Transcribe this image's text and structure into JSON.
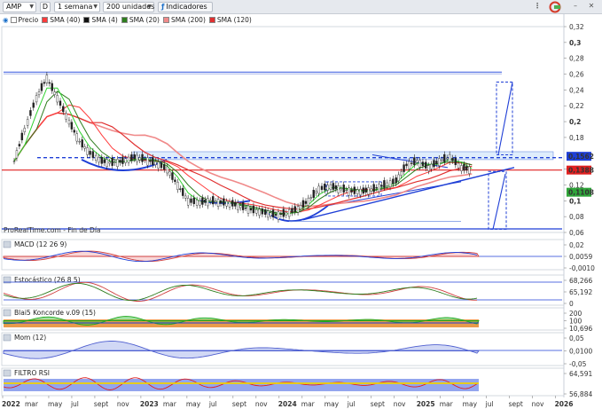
{
  "toolbar": {
    "ticker": "AMP",
    "d_label": "D",
    "period": "1 semana",
    "units": "200 unidades",
    "indicators": "Indicadores"
  },
  "legend": [
    {
      "label": "Precio",
      "color": "#ffffff"
    },
    {
      "label": "SMA (40)",
      "color": "#ff3b3b"
    },
    {
      "label": "SMA (4)",
      "color": "#111111"
    },
    {
      "label": "SMA (20)",
      "color": "#2e7d1e"
    },
    {
      "label": "SMA (200)",
      "color": "#f08a8a"
    },
    {
      "label": "SMA (120)",
      "color": "#e03030"
    }
  ],
  "watermark": "ProRealTime.com - Fin de Día",
  "price_axis": {
    "ticks": [
      "0,32",
      "0,3",
      "0,28",
      "0,26",
      "0,24",
      "0,22",
      "0,2",
      "0,18",
      "0,14",
      "0,12",
      "0,1",
      "0,08",
      "0,06"
    ],
    "bold_ticks": [
      "0,3",
      "0,2",
      "0,1"
    ],
    "badges": [
      {
        "text": "0,1562",
        "bg": "#1f3fd6"
      },
      {
        "text": "0,1388",
        "bg": "#e02020"
      },
      {
        "text": "0,1108",
        "bg": "#2fa53a"
      }
    ]
  },
  "panels": [
    {
      "id": "macd",
      "title": "MACD (12 26 9)",
      "ticks": [
        "0,02",
        "0,0059",
        "-0,0010"
      ]
    },
    {
      "id": "stoch",
      "title": "Estocástico (26 8 5)",
      "ticks": [
        "68,266",
        "65,192",
        "0"
      ]
    },
    {
      "id": "blai5",
      "title": "Blai5 Koncorde v.09 (15)",
      "ticks": [
        "200",
        "100",
        "10,696"
      ]
    },
    {
      "id": "mom",
      "title": "Mom (12)",
      "ticks": [
        "0,05",
        "0,0100",
        "-0,05"
      ]
    },
    {
      "id": "rsi",
      "title": "FILTRO RSI",
      "ticks": [
        "64,591",
        "56,884"
      ]
    }
  ],
  "x_axis": [
    "2022",
    "mar",
    "may",
    "jul",
    "sept",
    "nov",
    "2023",
    "mar",
    "may",
    "jul",
    "sept",
    "nov",
    "2024",
    "mar",
    "may",
    "jul",
    "sept",
    "nov",
    "2025",
    "mar",
    "may",
    "jul",
    "sept",
    "nov",
    "2026"
  ],
  "x_axis_bold": [
    "2022",
    "2023",
    "2024",
    "2025",
    "2026"
  ],
  "chart_data": {
    "type": "line",
    "title": "",
    "price_series": {
      "name": "Precio",
      "x": [
        2022.0,
        2022.08,
        2022.17,
        2022.25,
        2022.33,
        2022.42,
        2022.5,
        2022.58,
        2022.67,
        2022.75,
        2022.83,
        2022.92,
        2023.0,
        2023.08,
        2023.17,
        2023.25,
        2023.33,
        2023.42,
        2023.5,
        2023.58,
        2023.67,
        2023.75,
        2023.83,
        2023.92,
        2024.0,
        2024.08,
        2024.17,
        2024.25,
        2024.33,
        2024.42,
        2024.5,
        2024.58,
        2024.67,
        2024.75,
        2024.83,
        2024.92,
        2025.0,
        2025.08,
        2025.17,
        2025.25,
        2025.33,
        2025.42,
        2025.5
      ],
      "values": [
        0.15,
        0.19,
        0.23,
        0.255,
        0.23,
        0.2,
        0.175,
        0.16,
        0.15,
        0.148,
        0.15,
        0.155,
        0.152,
        0.148,
        0.14,
        0.12,
        0.1,
        0.098,
        0.1,
        0.098,
        0.096,
        0.092,
        0.088,
        0.085,
        0.082,
        0.084,
        0.09,
        0.1,
        0.115,
        0.118,
        0.115,
        0.112,
        0.112,
        0.115,
        0.12,
        0.125,
        0.145,
        0.15,
        0.142,
        0.15,
        0.155,
        0.142,
        0.139
      ]
    },
    "horizontal_levels": [
      0.2615,
      0.1545,
      0.1388,
      0.0645
    ],
    "y_range": [
      0.06,
      0.32
    ],
    "last_values": {
      "price": 0.1562,
      "sma_red": 0.1388,
      "sma_green": 0.1108
    }
  }
}
